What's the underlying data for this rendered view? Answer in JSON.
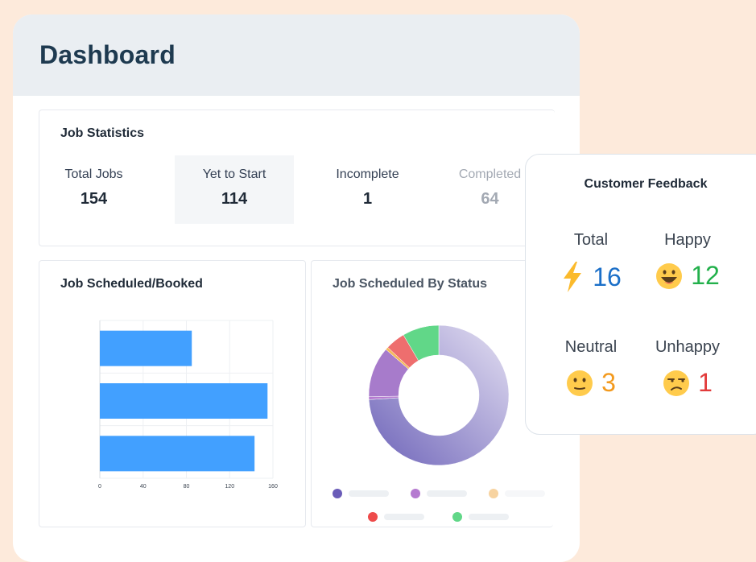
{
  "dashboard": {
    "title": "Dashboard"
  },
  "job_statistics": {
    "title": "Job Statistics",
    "items": [
      {
        "label": "Total Jobs",
        "value": "154"
      },
      {
        "label": "Yet to Start",
        "value": "114"
      },
      {
        "label": "Incomplete",
        "value": "1"
      },
      {
        "label": "Completed",
        "value": "64"
      }
    ]
  },
  "job_scheduled": {
    "title": "Job Scheduled/Booked"
  },
  "job_status": {
    "title": "Job Scheduled By Status"
  },
  "customer_feedback": {
    "title": "Customer Feedback",
    "total": {
      "label": "Total",
      "value": "16",
      "icon": "lightning-icon",
      "color": "#1B6FC8"
    },
    "happy": {
      "label": "Happy",
      "value": "12",
      "icon": "grinning-face-icon",
      "color": "#22B04B"
    },
    "neutral": {
      "label": "Neutral",
      "value": "3",
      "icon": "neutral-face-icon",
      "color": "#F39A1E"
    },
    "unhappy": {
      "label": "Unhappy",
      "value": "1",
      "icon": "unamused-face-icon",
      "color": "#E23B3B"
    }
  },
  "chart_data": [
    {
      "type": "bar",
      "orientation": "horizontal",
      "title": "Job Scheduled/Booked",
      "categories": [
        "",
        "",
        ""
      ],
      "values": [
        85,
        155,
        143
      ],
      "xlim": [
        0,
        160
      ],
      "xticks": [
        "0",
        "40",
        "80",
        "120",
        "160"
      ],
      "grid": true,
      "color": "#42A0FF"
    },
    {
      "type": "pie",
      "title": "Job Scheduled By Status",
      "donut": true,
      "slices": [
        {
          "value": 114,
          "color": "#8C82CC"
        },
        {
          "value": 1,
          "color": "#B57AD0"
        },
        {
          "value": 18,
          "color": "#A77BCB"
        },
        {
          "value": 1,
          "color": "#F5B95A"
        },
        {
          "value": 7,
          "color": "#EE6E6E"
        },
        {
          "value": 13,
          "color": "#61D788"
        }
      ],
      "legend_colors": [
        "#6A5CB8",
        "#B57AD0",
        "#F7D3A0",
        "#EE4B4B",
        "#61D788"
      ]
    }
  ]
}
